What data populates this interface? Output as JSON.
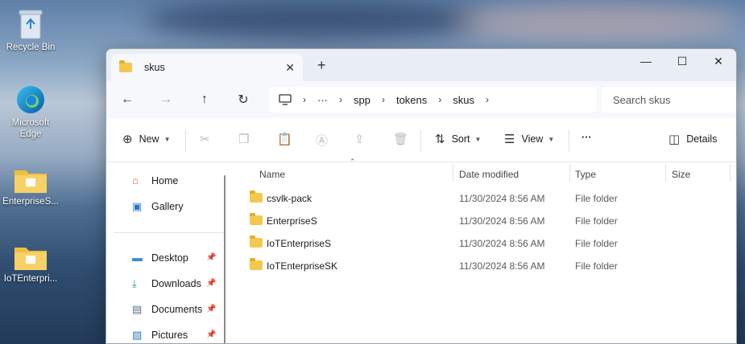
{
  "desktop": {
    "icons": [
      {
        "label": "Recycle Bin",
        "icon": "recycle-bin-icon"
      },
      {
        "label": "Microsoft Edge",
        "icon": "edge-icon"
      },
      {
        "label": "EnterpriseS...",
        "icon": "folder-icon"
      },
      {
        "label": "IoTEnterpri...",
        "icon": "folder-icon"
      }
    ]
  },
  "window": {
    "tab_title": "skus",
    "controls": {
      "minimize": "—",
      "maximize": "☐",
      "close": "✕"
    }
  },
  "navigation": {
    "path_overflow": "···",
    "path": [
      "spp",
      "tokens",
      "skus"
    ],
    "search_placeholder": "Search skus"
  },
  "toolbar": {
    "new_label": "New",
    "sort_label": "Sort",
    "view_label": "View",
    "more_label": "···",
    "details_label": "Details"
  },
  "sidebar": {
    "top_items": [
      {
        "label": "Home",
        "icon": "home-icon"
      },
      {
        "label": "Gallery",
        "icon": "gallery-icon"
      }
    ],
    "quick_access": [
      {
        "label": "Desktop",
        "icon": "desktop-icon"
      },
      {
        "label": "Downloads",
        "icon": "download-icon"
      },
      {
        "label": "Documents",
        "icon": "documents-icon"
      },
      {
        "label": "Pictures",
        "icon": "pictures-icon"
      }
    ]
  },
  "file_list": {
    "columns": {
      "name": "Name",
      "date": "Date modified",
      "type": "Type",
      "size": "Size"
    },
    "rows": [
      {
        "name": "csvlk-pack",
        "date": "11/30/2024 8:56 AM",
        "type": "File folder"
      },
      {
        "name": "EnterpriseS",
        "date": "11/30/2024 8:56 AM",
        "type": "File folder"
      },
      {
        "name": "IoTEnterpriseS",
        "date": "11/30/2024 8:56 AM",
        "type": "File folder"
      },
      {
        "name": "IoTEnterpriseSK",
        "date": "11/30/2024 8:56 AM",
        "type": "File folder"
      }
    ]
  },
  "colors": {
    "accent": "#0067c0",
    "folder": "#f4c84e"
  }
}
